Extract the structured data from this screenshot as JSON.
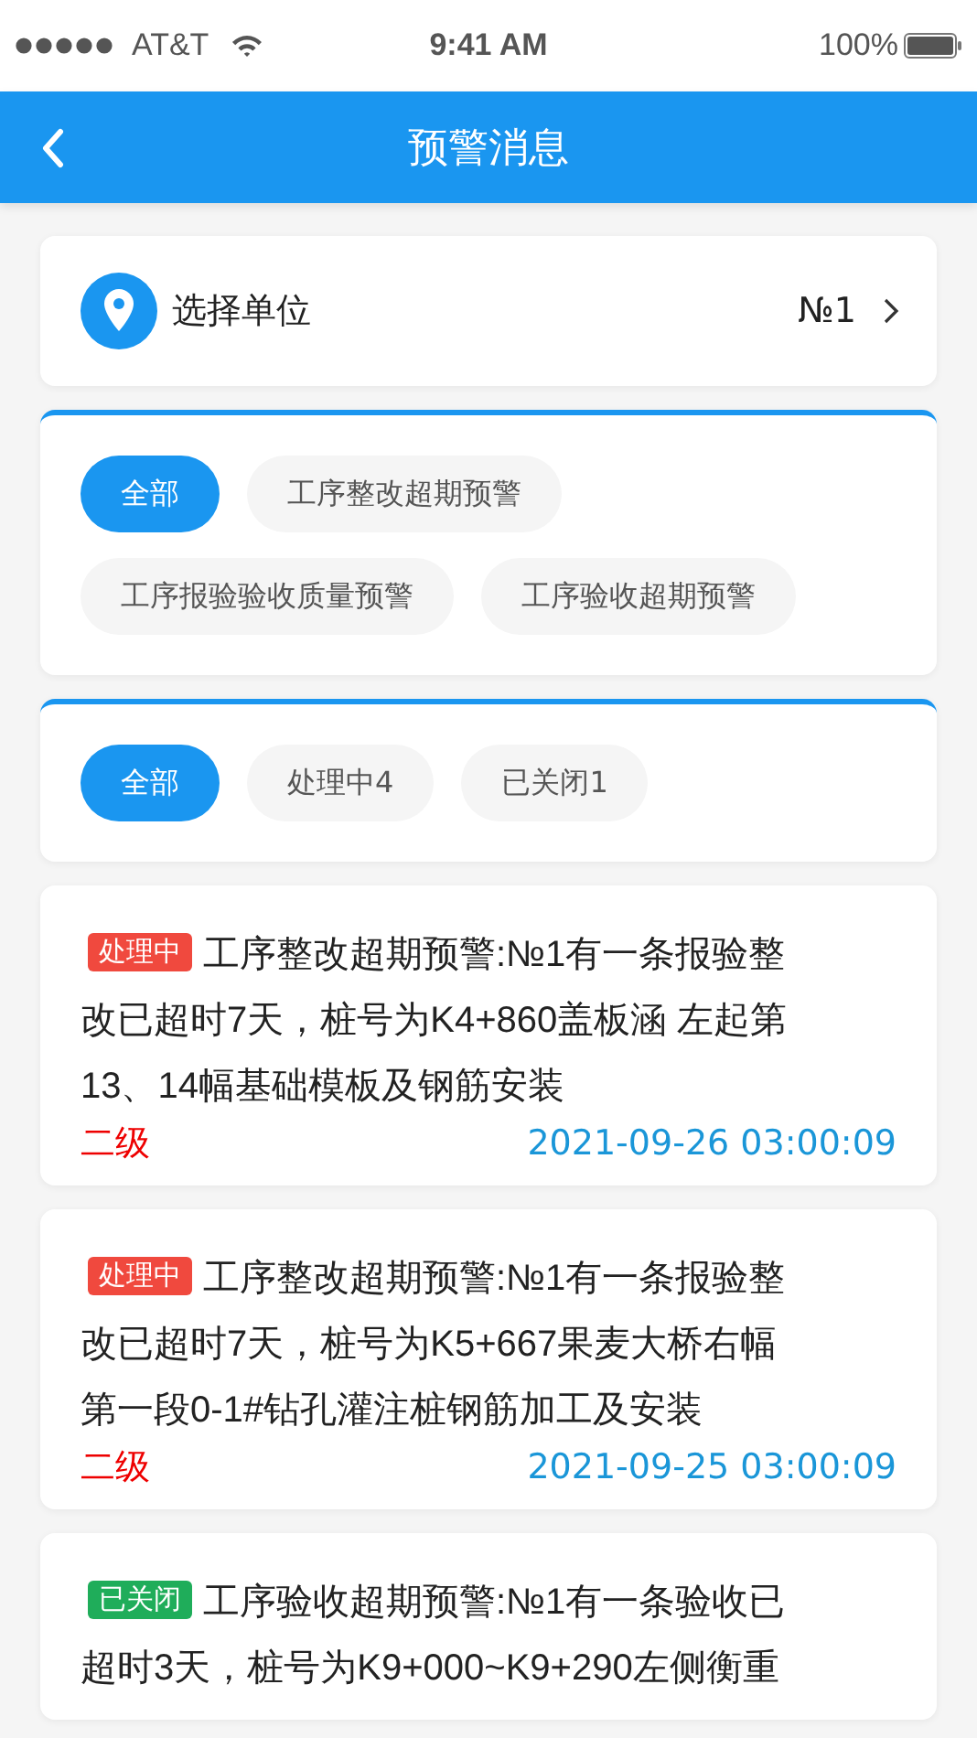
{
  "status_bar": {
    "carrier": "AT&T",
    "time": "9:41 AM",
    "battery": "100%"
  },
  "header": {
    "title": "预警消息"
  },
  "unit_selector": {
    "label": "选择单位",
    "value": "№1"
  },
  "type_filters": [
    {
      "label": "全部",
      "selected": true
    },
    {
      "label": "工序整改超期预警",
      "selected": false
    },
    {
      "label": "工序报验验收质量预警",
      "selected": false
    },
    {
      "label": "工序验收超期预警",
      "selected": false
    }
  ],
  "status_filters": [
    {
      "label": "全部",
      "selected": true
    },
    {
      "label": "处理中4",
      "selected": false
    },
    {
      "label": "已关闭1",
      "selected": false
    }
  ],
  "messages": [
    {
      "status": "处理中",
      "kind": "processing",
      "lines": [
        "工序整改超期预警:№1有一条报验整",
        "改已超时7天，桩号为K4+860盖板涵 左起第",
        "13、14幅基础模板及钢筋安装"
      ],
      "level_label": "二级",
      "time": "2021-09-26 03:00:09"
    },
    {
      "status": "处理中",
      "kind": "processing",
      "lines": [
        "工序整改超期预警:№1有一条报验整",
        "改已超时7天，桩号为K5+667果麦大桥右幅",
        "第一段0-1#钻孔灌注桩钢筋加工及安装"
      ],
      "level_label": "二级",
      "time": "2021-09-25 03:00:09"
    },
    {
      "status": "已关闭",
      "kind": "closed",
      "lines": [
        "工序验收超期预警:№1有一条验收已",
        "超时3天，桩号为K9+000~K9+290左侧衡重"
      ]
    }
  ]
}
